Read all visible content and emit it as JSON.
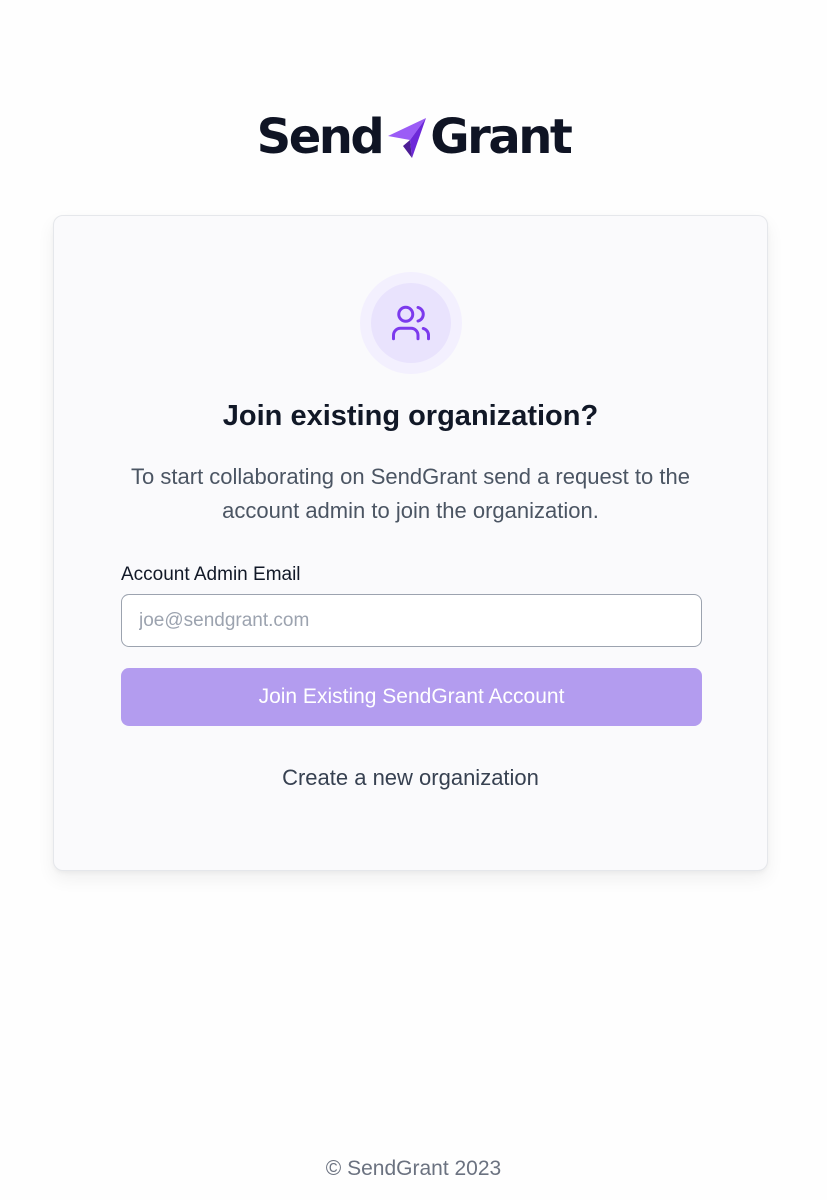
{
  "brand": {
    "name_part1": "Send",
    "name_part2": "Grant",
    "accent_color": "#7c3aed",
    "logo_icon": "paper-plane-icon"
  },
  "card": {
    "icon": "users-icon",
    "title": "Join existing organization?",
    "description": "To start collaborating on SendGrant send a request to the account admin to join the organization.",
    "email_label": "Account Admin Email",
    "email_placeholder": "joe@sendgrant.com",
    "email_value": "",
    "join_button_label": "Join Existing SendGrant Account",
    "join_button_color": "#b39cef",
    "create_link_label": "Create a new organization"
  },
  "footer": {
    "copyright": "© SendGrant 2023"
  }
}
